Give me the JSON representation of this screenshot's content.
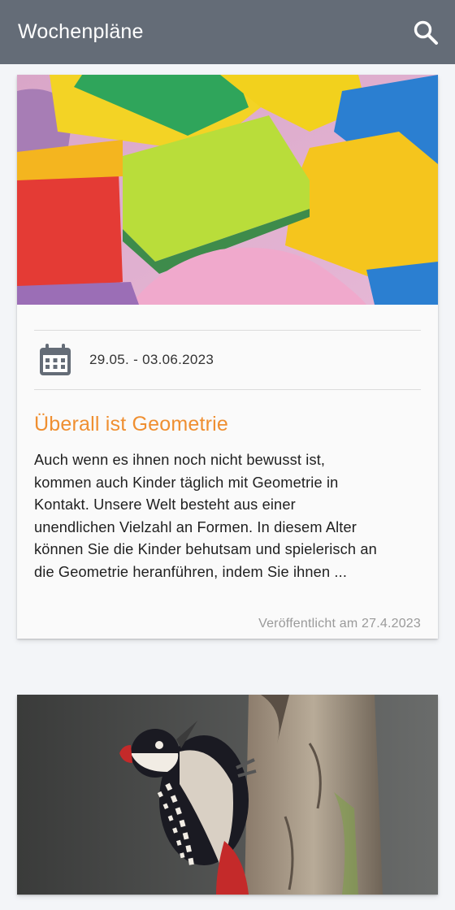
{
  "appbar": {
    "title": "Wochenpläne",
    "search_icon": "search-icon",
    "color": "#646c77"
  },
  "posts": [
    {
      "image": "colorful-sponges-photo",
      "date_range": "29.05. - 03.06.2023",
      "date_icon": "calendar-icon",
      "title": "Überall ist Geometrie",
      "excerpt_lines": [
        "Auch wenn es ihnen noch nicht bewusst ist,",
        "kommen auch Kinder täglich mit Geometrie in",
        "Kontakt. Unsere Welt besteht aus einer",
        "unendlichen Vielzahl an Formen. In diesem Alter",
        "können Sie die Kinder behutsam und spielerisch an",
        "die Geometrie heranführen, indem Sie ihnen ..."
      ],
      "published": "Veröffentlicht am 27.4.2023",
      "title_color": "#ef8f31"
    },
    {
      "image": "woodpecker-photo"
    }
  ]
}
